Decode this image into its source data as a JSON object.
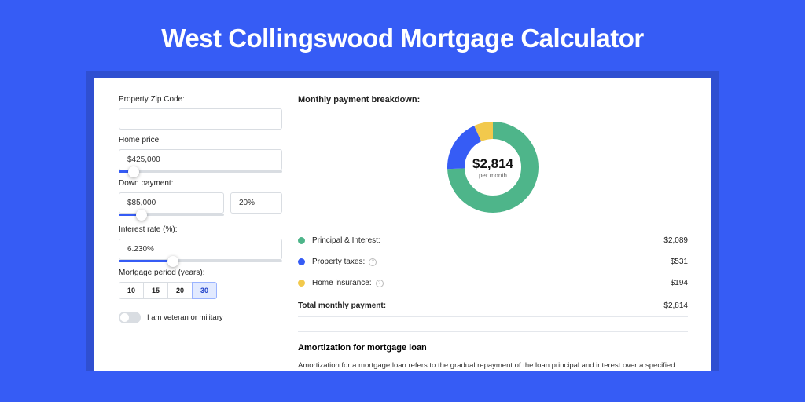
{
  "title": "West Collingswood Mortgage Calculator",
  "form": {
    "zip_label": "Property Zip Code:",
    "zip_value": "",
    "price_label": "Home price:",
    "price_value": "$425,000",
    "price_pct": 9,
    "down_label": "Down payment:",
    "down_value": "$85,000",
    "down_pct_value": "20%",
    "down_slider_pct": 22,
    "rate_label": "Interest rate (%):",
    "rate_value": "6.230%",
    "rate_slider_pct": 33,
    "period_label": "Mortgage period (years):",
    "periods": [
      "10",
      "15",
      "20",
      "30"
    ],
    "period_active": 3,
    "veteran_label": "I am veteran or military"
  },
  "breakdown": {
    "heading": "Monthly payment breakdown:",
    "center_amount": "$2,814",
    "center_sub": "per month",
    "items": [
      {
        "label": "Principal & Interest:",
        "value": "$2,089",
        "color": "#4eb58a",
        "info": false
      },
      {
        "label": "Property taxes:",
        "value": "$531",
        "color": "#365cf5",
        "info": true
      },
      {
        "label": "Home insurance:",
        "value": "$194",
        "color": "#f2c94c",
        "info": true
      }
    ],
    "total_label": "Total monthly payment:",
    "total_value": "$2,814"
  },
  "amort": {
    "heading": "Amortization for mortgage loan",
    "text": "Amortization for a mortgage loan refers to the gradual repayment of the loan principal and interest over a specified"
  },
  "chart_data": {
    "type": "pie",
    "title": "Monthly payment breakdown",
    "series": [
      {
        "name": "Monthly payment",
        "values": [
          2089,
          531,
          194
        ]
      }
    ],
    "categories": [
      "Principal & Interest",
      "Property taxes",
      "Home insurance"
    ],
    "colors": [
      "#4eb58a",
      "#365cf5",
      "#f2c94c"
    ],
    "total": 2814,
    "unit": "USD per month"
  }
}
